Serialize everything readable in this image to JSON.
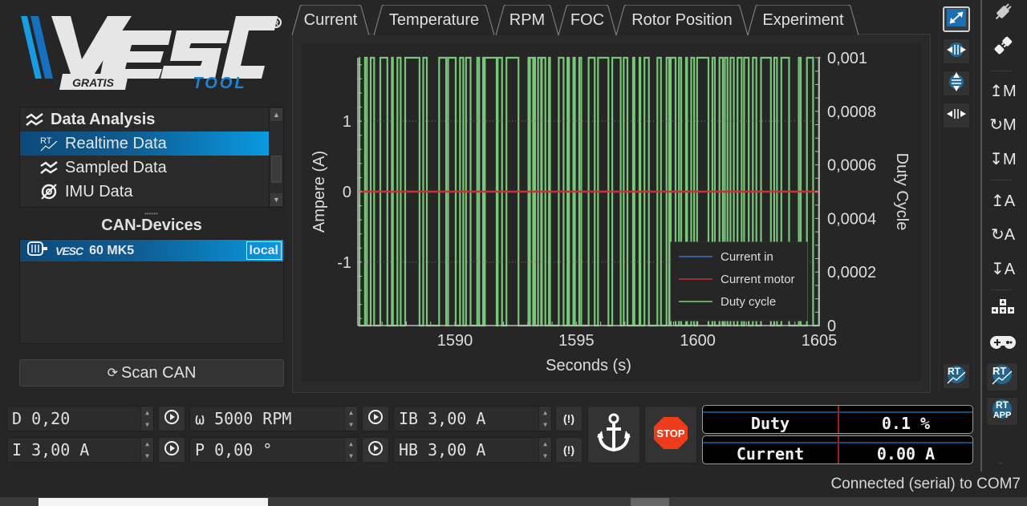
{
  "app": {
    "logo": {
      "brand": "VESC",
      "badge": "GRATIS",
      "subtitle": "TOOL",
      "registered": "®"
    }
  },
  "sidebar": {
    "nav_items": [
      {
        "label": "Data Analysis",
        "icon": "chart-analysis-icon",
        "type": "header"
      },
      {
        "label": "Realtime Data",
        "icon": "realtime-icon",
        "selected": true
      },
      {
        "label": "Sampled Data",
        "icon": "sampled-data-icon"
      },
      {
        "label": "IMU Data",
        "icon": "imu-icon"
      }
    ],
    "can_devices_title": "CAN-Devices",
    "can_devices": [
      {
        "logo": "VESC",
        "name": "60 MK5",
        "tag": "local",
        "icon": "motor-icon"
      }
    ],
    "scan_can_label": "Scan CAN"
  },
  "tabs": [
    {
      "label": "Current",
      "active": true
    },
    {
      "label": "Temperature"
    },
    {
      "label": "RPM"
    },
    {
      "label": "FOC"
    },
    {
      "label": "Rotor Position"
    },
    {
      "label": "Experiment"
    }
  ],
  "chart_data": {
    "type": "line",
    "title": "",
    "xlabel": "Seconds (s)",
    "ylabel": "Ampere (A)",
    "y2label": "Duty Cycle",
    "xlim": [
      1586,
      1605
    ],
    "ylim": [
      -1.9,
      1.9
    ],
    "y2lim": [
      0,
      0.001
    ],
    "x_ticks": [
      "1590",
      "1595",
      "1600",
      "1605"
    ],
    "y_ticks": [
      "1",
      "0",
      "-1"
    ],
    "y2_ticks": [
      "0,001",
      "0,0008",
      "0,0006",
      "0,0004",
      "0,0002",
      "0"
    ],
    "grid": true,
    "legend_position": "bottom-right",
    "series": [
      {
        "name": "Current in",
        "color": "#3a6fc4",
        "axis": "left",
        "description": "constant 0",
        "value": 0
      },
      {
        "name": "Current motor",
        "color": "#c83232",
        "axis": "left",
        "description": "constant 0",
        "value": 0
      },
      {
        "name": "Duty cycle",
        "color": "#7ccf7c",
        "axis": "right",
        "description": "toggles rapidly between 0 and 0.001",
        "values_range": [
          0,
          0.001
        ]
      }
    ]
  },
  "controls": {
    "duty": "D 0,20",
    "current": "I 3,00 A",
    "rpm": "ω 5000 RPM",
    "position": "P 0,00 °",
    "brake_current": "IB 3,00 A",
    "handbrake": "HB 3,00 A",
    "anchor_label": "anchor",
    "stop_label": "STOP"
  },
  "gauges": [
    {
      "label": "Duty",
      "value": "0.1 %"
    },
    {
      "label": "Current",
      "value": "0.00 A"
    }
  ],
  "toolbar": {
    "items": [
      {
        "name": "connect",
        "icon": "plug-connect-icon"
      },
      {
        "name": "disconnect",
        "icon": "plug-disconnect-icon"
      },
      {
        "name": "read-motor-config",
        "label": "↥M"
      },
      {
        "name": "reset-motor-config",
        "label": "↻M"
      },
      {
        "name": "write-motor-config",
        "label": "↧M"
      },
      {
        "name": "read-app-config",
        "label": "↥A"
      },
      {
        "name": "reset-app-config",
        "label": "↻A"
      },
      {
        "name": "write-app-config",
        "label": "↧A"
      },
      {
        "name": "keyboard-control",
        "icon": "arrow-keys-icon"
      },
      {
        "name": "gamepad-control",
        "icon": "gamepad-icon"
      },
      {
        "name": "rt-data",
        "label": "RT"
      },
      {
        "name": "rt-app-data",
        "label": "RT APP"
      }
    ]
  },
  "status": {
    "text": "Connected (serial) to COM7"
  }
}
